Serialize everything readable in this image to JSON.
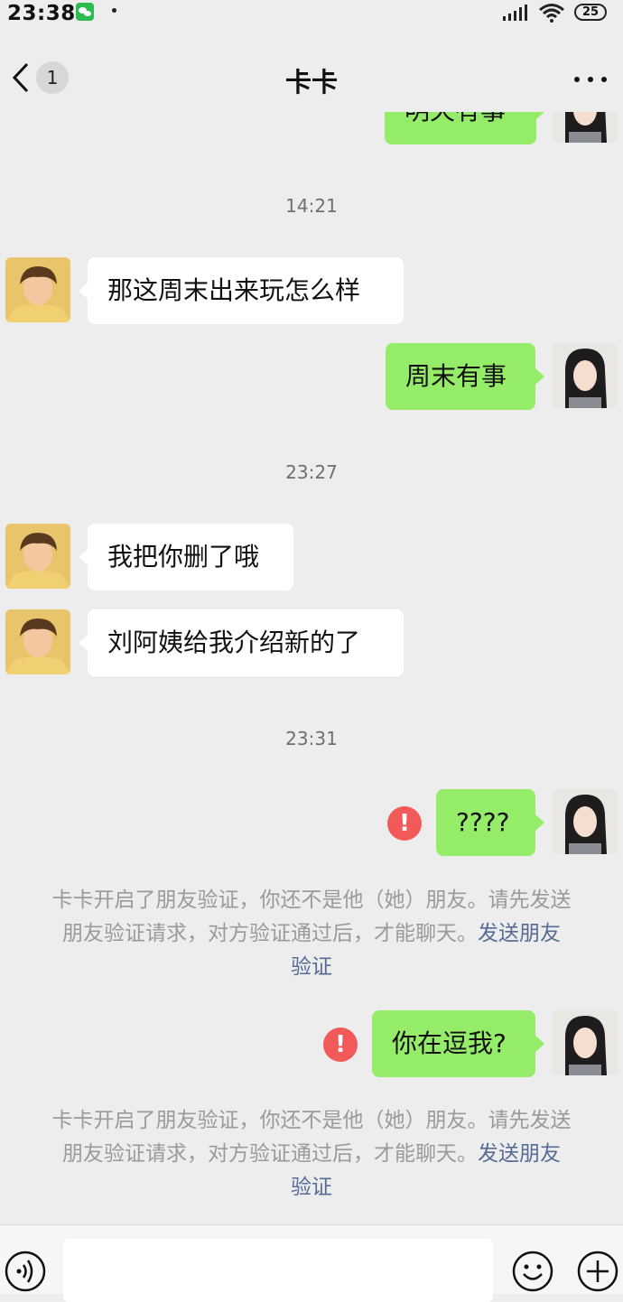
{
  "status_bar": {
    "time": "23:38",
    "battery": "25"
  },
  "header": {
    "unread_count": "1",
    "title": "卡卡"
  },
  "top_partial_message": "明天有事",
  "timestamps": [
    "14:21",
    "23:27",
    "23:31"
  ],
  "messages": [
    {
      "side": "left",
      "text": "那这周末出来玩怎么样"
    },
    {
      "side": "right",
      "text": "周末有事"
    },
    {
      "side": "left",
      "text": "我把你删了哦"
    },
    {
      "side": "left",
      "text": "刘阿姨给我介绍新的了"
    },
    {
      "side": "right",
      "text": "????",
      "failed": true
    },
    {
      "side": "right",
      "text": "你在逗我?",
      "failed": true
    }
  ],
  "error_icon_glyph": "!",
  "notices": [
    {
      "line1": "卡卡开启了朋友验证，你还不是他（她）朋友。请先发送",
      "line2": "朋友验证请求，对方验证通过后，才能聊天。",
      "link": "发送朋友",
      "line3": "验证"
    },
    {
      "line1": "卡卡开启了朋友验证，你还不是他（她）朋友。请先发送",
      "line2": "朋友验证请求，对方验证通过后，才能聊天。",
      "link": "发送朋友",
      "line3": "验证"
    }
  ],
  "colors": {
    "self_bubble": "#95ec69",
    "other_bubble": "#ffffff",
    "link": "#576b95",
    "error": "#f25a5a",
    "background": "#ededed"
  },
  "icons": [
    "back-icon",
    "more-icon",
    "voice-icon",
    "emoji-icon",
    "plus-icon",
    "error-icon",
    "signal-icon",
    "wifi-icon"
  ]
}
